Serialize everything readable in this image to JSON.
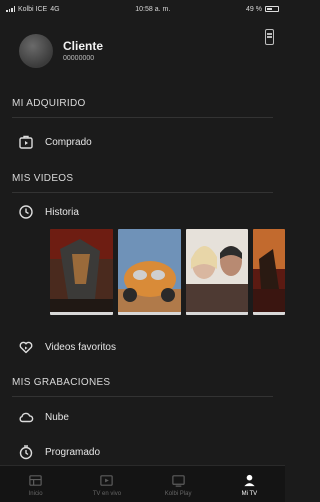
{
  "status_bar": {
    "carrier": "Kolbi ICE",
    "network": "4G",
    "time": "10:58 a. m.",
    "battery": "49 %"
  },
  "profile": {
    "name": "Cliente",
    "id": "00000000"
  },
  "sections": {
    "adquirido": {
      "title": "MI ADQUIRIDO",
      "item": "Comprado"
    },
    "videos": {
      "title": "MIS VIDEOS",
      "history": "Historia",
      "favorites": "Videos favoritos"
    },
    "grabaciones": {
      "title": "MIS GRABACIONES",
      "cloud": "Nube",
      "scheduled": "Programado"
    }
  },
  "history_posters": [
    {
      "name": "transformers",
      "colors": [
        "#6e1d12",
        "#3b3a38",
        "#9a6a3a"
      ]
    },
    {
      "name": "cars",
      "colors": [
        "#6f92b8",
        "#d98b38",
        "#cfcfcf"
      ]
    },
    {
      "name": "drama",
      "colors": [
        "#e6e1da",
        "#7a5e4e",
        "#2c2c2c"
      ]
    },
    {
      "name": "action",
      "colors": [
        "#c26a2e",
        "#5b1a12",
        "#2a1a12"
      ]
    }
  ],
  "tabs": [
    {
      "label": "Inicio",
      "icon": "home-icon",
      "active": false
    },
    {
      "label": "TV en vivo",
      "icon": "play-tv-icon",
      "active": false
    },
    {
      "label": "Kolbi Play",
      "icon": "screen-icon",
      "active": false
    },
    {
      "label": "Mi TV",
      "icon": "person-icon",
      "active": true
    }
  ],
  "colors": {
    "background": "#1b1b1b",
    "text": "#e6e6e6",
    "section": "#d9d9d9",
    "accent_active": "#ffffff"
  }
}
